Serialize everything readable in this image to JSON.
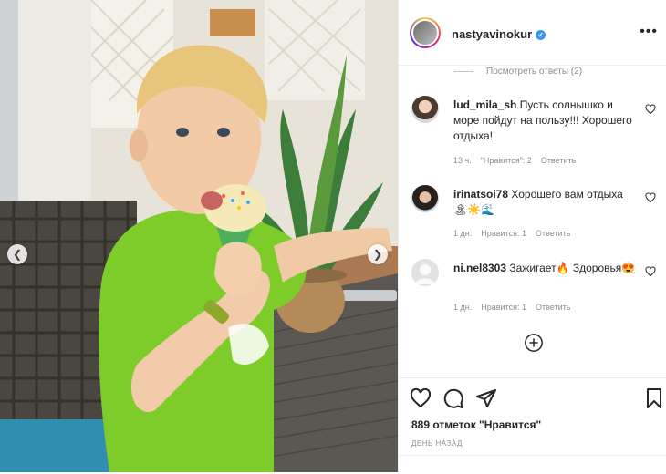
{
  "post": {
    "username": "nastyavinokur",
    "more_label": "•••",
    "view_replies": "Посмотреть ответы (2)",
    "comments": [
      {
        "user": "lud_mila_sh",
        "text": " Пусть солнышко и море пойдут на пользу!!! Хорошего отдыха!",
        "time": "13 ч.",
        "likes": "\"Нравится\": 2",
        "reply": "Ответить"
      },
      {
        "user": "irinatsoi78",
        "text": " Хорошего вам отдыха🏝☀️🌊",
        "time": "1 дн.",
        "likes": "Нравится: 1",
        "reply": "Ответить"
      },
      {
        "user": "ni.nel8303",
        "text": " Зажигает🔥 Здоровья😍",
        "time": "1 дн.",
        "likes": "Нравится: 1",
        "reply": "Ответить"
      }
    ],
    "likes_count": "889 отметок \"Нравится\"",
    "date_label": "ДЕНЬ НАЗАД"
  },
  "icons": {
    "verified": "verified-badge-icon",
    "heart": "heart-icon",
    "comment": "comment-icon",
    "share": "share-icon",
    "bookmark": "bookmark-icon",
    "add": "add-circle-icon",
    "prev": "chevron-left-icon",
    "next": "chevron-right-icon"
  },
  "colors": {
    "verified": "#3897f0",
    "muted": "#8e8e8e",
    "shirt": "#7dcc2a"
  }
}
